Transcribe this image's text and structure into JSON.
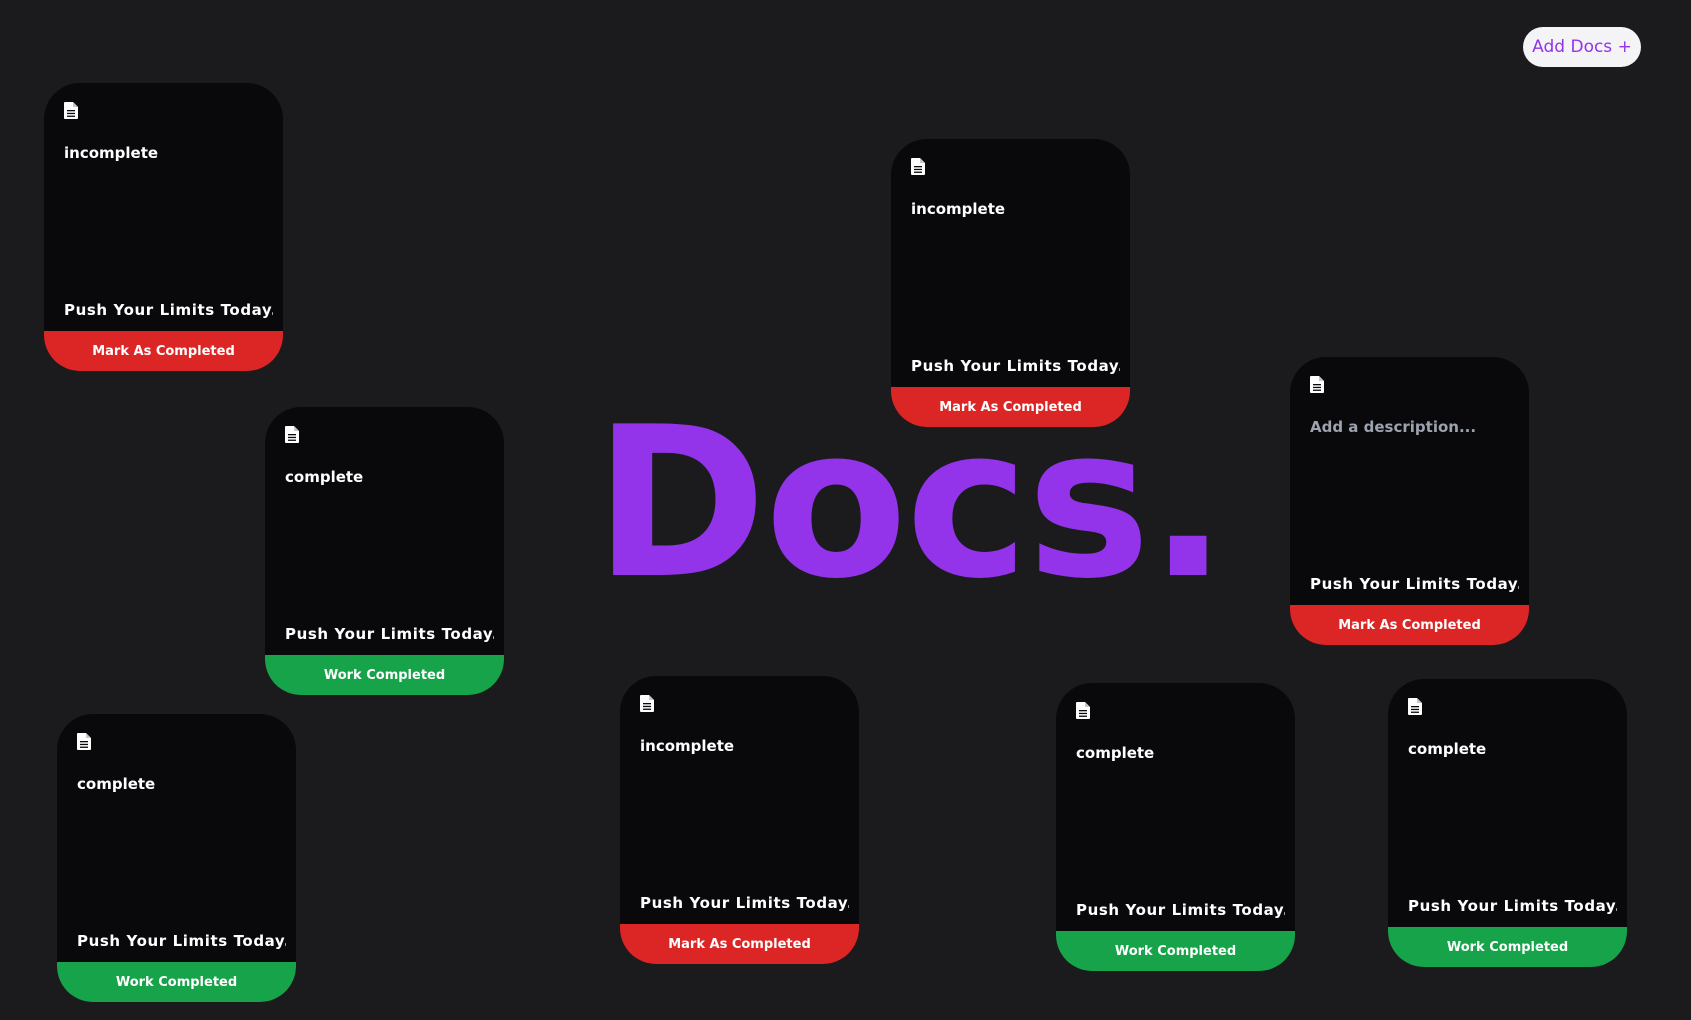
{
  "app": {
    "watermark": "Docs.",
    "add_button_label": "Add Docs +"
  },
  "colors": {
    "background": "#1b1b1d",
    "card": "#09090b",
    "accent_purple": "#9333ea",
    "incomplete_red": "#dc2626",
    "complete_green": "#16a34a"
  },
  "cards": [
    {
      "icon": "document-icon",
      "description": "incomplete",
      "title": "Push Your Limits Today...",
      "action_label": "Mark As Completed",
      "status": "incomplete"
    },
    {
      "icon": "document-icon",
      "description": "complete",
      "title": "Push Your Limits Today...",
      "action_label": "Work Completed",
      "status": "complete"
    },
    {
      "icon": "document-icon",
      "description": "complete",
      "title": "Push Your Limits Today...",
      "action_label": "Work Completed",
      "status": "complete"
    },
    {
      "icon": "document-icon",
      "description": "incomplete",
      "title": "Push Your Limits Today...",
      "action_label": "Mark As Completed",
      "status": "incomplete"
    },
    {
      "icon": "document-icon",
      "description": "incomplete",
      "title": "Push Your Limits Today...",
      "action_label": "Mark As Completed",
      "status": "incomplete"
    },
    {
      "icon": "document-icon",
      "description": "",
      "placeholder": "Add a description...",
      "title": "Push Your Limits Today...",
      "action_label": "Mark As Completed",
      "status": "incomplete"
    },
    {
      "icon": "document-icon",
      "description": "complete",
      "title": "Push Your Limits Today...",
      "action_label": "Work Completed",
      "status": "complete"
    },
    {
      "icon": "document-icon",
      "description": "complete",
      "title": "Push Your Limits Today...",
      "action_label": "Work Completed",
      "status": "complete"
    }
  ]
}
